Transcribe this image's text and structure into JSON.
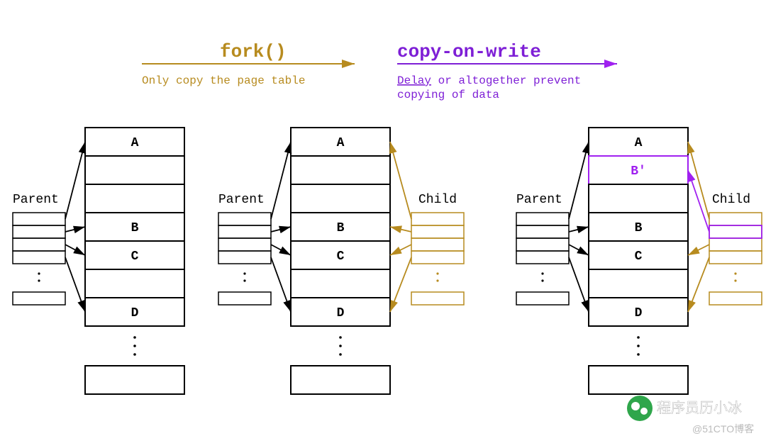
{
  "header": {
    "fork_label": "fork()",
    "fork_caption": "Only copy the page table",
    "cow_label": "copy-on-write",
    "cow_caption_underlined": "Delay",
    "cow_caption_rest": " or altogether prevent\ncopying of data"
  },
  "labels": {
    "parent": "Parent",
    "child": "Child"
  },
  "pages": {
    "original": [
      "A",
      "",
      "",
      "B",
      "C",
      "",
      "D"
    ],
    "after_cow": [
      "A",
      "B'",
      "",
      "B",
      "C",
      "",
      "D"
    ]
  },
  "colors": {
    "fork_label": "#b78b1f",
    "fork_caption": "#b78b1f",
    "cow_label": "#7e1fd6",
    "cow_caption": "#7e1fd6",
    "parent_arrow": "#000000",
    "child_arrow": "#b78b1f",
    "cow_arrow": "#a020f0",
    "table_border": "#000000",
    "child_table": "#b78b1f",
    "cow_cell": "#a020f0"
  },
  "watermark": {
    "brand": "程序员历小冰",
    "site": "@51CTO博客"
  }
}
